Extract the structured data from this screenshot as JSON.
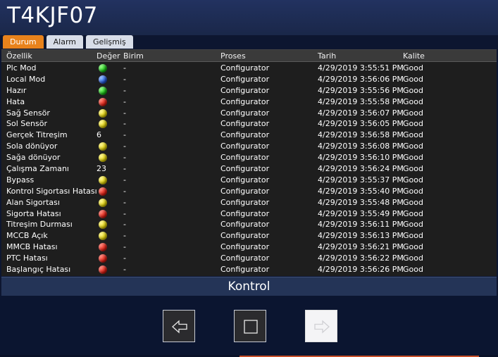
{
  "header": {
    "title": "T4KJF07"
  },
  "tabs": [
    {
      "label": "Durum",
      "active": true
    },
    {
      "label": "Alarm",
      "active": false
    },
    {
      "label": "Gelişmiş",
      "active": false
    }
  ],
  "table": {
    "columns": [
      "Özellik",
      "Değer",
      "Birim",
      "Proses",
      "Tarih",
      "Kalite"
    ],
    "rows": [
      {
        "name": "Plc Mod",
        "led": "green",
        "value": "",
        "unit": "-",
        "process": "Configurator",
        "date": "4/29/2019 3:55:51 PM",
        "quality": "Good"
      },
      {
        "name": "Local Mod",
        "led": "blue",
        "value": "",
        "unit": "-",
        "process": "Configurator",
        "date": "4/29/2019 3:56:06 PM",
        "quality": "Good"
      },
      {
        "name": "Hazır",
        "led": "green",
        "value": "",
        "unit": "-",
        "process": "Configurator",
        "date": "4/29/2019 3:55:56 PM",
        "quality": "Good"
      },
      {
        "name": "Hata",
        "led": "red",
        "value": "",
        "unit": "-",
        "process": "Configurator",
        "date": "4/29/2019 3:55:58 PM",
        "quality": "Good"
      },
      {
        "name": "Sağ Sensör",
        "led": "yellow",
        "value": "",
        "unit": "-",
        "process": "Configurator",
        "date": "4/29/2019 3:56:07 PM",
        "quality": "Good"
      },
      {
        "name": "Sol Sensör",
        "led": "yellow",
        "value": "",
        "unit": "-",
        "process": "Configurator",
        "date": "4/29/2019 3:56:05 PM",
        "quality": "Good"
      },
      {
        "name": "Gerçek Titreşim",
        "led": "",
        "value": "6",
        "unit": "-",
        "process": "Configurator",
        "date": "4/29/2019 3:56:58 PM",
        "quality": "Good"
      },
      {
        "name": "Sola dönüyor",
        "led": "yellow",
        "value": "",
        "unit": "-",
        "process": "Configurator",
        "date": "4/29/2019 3:56:08 PM",
        "quality": "Good"
      },
      {
        "name": "Sağa dönüyor",
        "led": "yellow",
        "value": "",
        "unit": "-",
        "process": "Configurator",
        "date": "4/29/2019 3:56:10 PM",
        "quality": "Good"
      },
      {
        "name": "Çalışma Zamanı",
        "led": "",
        "value": "23",
        "unit": "-",
        "process": "Configurator",
        "date": "4/29/2019 3:56:24 PM",
        "quality": "Good"
      },
      {
        "name": "Bypass",
        "led": "yellow",
        "value": "",
        "unit": "-",
        "process": "Configurator",
        "date": "4/29/2019 3:55:37 PM",
        "quality": "Good"
      },
      {
        "name": "Kontrol Sigortası Hatası",
        "led": "red",
        "value": "",
        "unit": "-",
        "process": "Configurator",
        "date": "4/29/2019 3:55:40 PM",
        "quality": "Good"
      },
      {
        "name": "Alan Sigortası",
        "led": "yellow",
        "value": "",
        "unit": "-",
        "process": "Configurator",
        "date": "4/29/2019 3:55:48 PM",
        "quality": "Good"
      },
      {
        "name": "Sigorta Hatası",
        "led": "red",
        "value": "",
        "unit": "-",
        "process": "Configurator",
        "date": "4/29/2019 3:55:49 PM",
        "quality": "Good"
      },
      {
        "name": "Titreşim Durması",
        "led": "yellow",
        "value": "",
        "unit": "-",
        "process": "Configurator",
        "date": "4/29/2019 3:56:11 PM",
        "quality": "Good"
      },
      {
        "name": "MCCB Açık",
        "led": "yellow",
        "value": "",
        "unit": "-",
        "process": "Configurator",
        "date": "4/29/2019 3:56:13 PM",
        "quality": "Good"
      },
      {
        "name": "MMCB Hatası",
        "led": "red",
        "value": "",
        "unit": "-",
        "process": "Configurator",
        "date": "4/29/2019 3:56:21 PM",
        "quality": "Good"
      },
      {
        "name": "PTC Hatası",
        "led": "red",
        "value": "",
        "unit": "-",
        "process": "Configurator",
        "date": "4/29/2019 3:56:22 PM",
        "quality": "Good"
      },
      {
        "name": "Başlangıç Hatası",
        "led": "red",
        "value": "",
        "unit": "-",
        "process": "Configurator",
        "date": "4/29/2019 3:56:26 PM",
        "quality": "Good"
      }
    ]
  },
  "control": {
    "label": "Kontrol",
    "buttons": [
      {
        "name": "previous-button",
        "icon": "arrow-left-icon"
      },
      {
        "name": "stop-button",
        "icon": "square-icon"
      },
      {
        "name": "next-button",
        "icon": "arrow-right-icon"
      }
    ]
  },
  "colors": {
    "accent_tab": "#e8821c",
    "led_green": "#10b010",
    "led_yellow": "#d8c800",
    "led_red": "#d41a10",
    "led_blue": "#2050d0"
  }
}
